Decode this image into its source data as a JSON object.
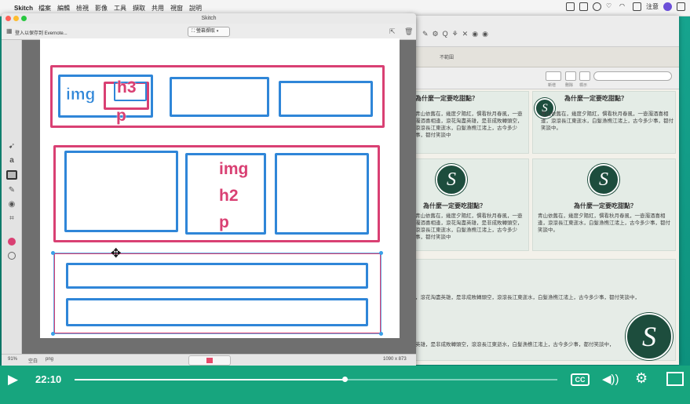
{
  "menubar": {
    "app_name": "Skitch",
    "items": [
      "檔案",
      "編輯",
      "檢視",
      "影像",
      "工具",
      "擷取",
      "共用",
      "視窗",
      "說明"
    ],
    "right_label": "注意"
  },
  "skitch": {
    "title": "Skitch",
    "evernote_login": "登入以保存到 Evernote...",
    "capture_label": "螢幕擷取",
    "zoom": "91%",
    "status_blank": "空白",
    "format": "png",
    "dimensions": "1090 x 873"
  },
  "diagram": {
    "row1": {
      "img": "img",
      "h3": "h3",
      "p": "p"
    },
    "row2": {
      "img": "img",
      "h2": "h2",
      "p": "p"
    }
  },
  "background_site": {
    "tab_label": "不範圍",
    "toolbar_labels": [
      "新增",
      "刪除",
      "標示"
    ],
    "card_title": "為什麼一定要吃甜點？",
    "card_text": "青山依舊在，幾度夕陽紅，慣看秋月春風，一壺濁酒喜相逢，滾滾長江東逝水，白髮漁樵江渚上，古今多少事，都付笑談中。",
    "card_text_short": "青山依舊在，幾度夕陽紅，慣看秋月春風，一壺濁酒喜相逢，滾花淘盡英雄，是非成敗轉頭空，滾滾長江東逝水，白髮漁樵江渚上，古今多少事，都付笑談中",
    "row_text_1": "，滾花淘盡英雄，是非成敗轉頭空，滾滾長江東逝水，白髮漁樵江渚上，古今多少事，都付笑談中，",
    "row_text_2": "英雄，是非成敗轉頭空，滾滾長江東逝水，白髮漁樵江渚上，古今多少事，都付笑談中，",
    "logo_letter": "S"
  },
  "video": {
    "time": "22:10",
    "progress": 0.56,
    "cc_label": "CC"
  }
}
